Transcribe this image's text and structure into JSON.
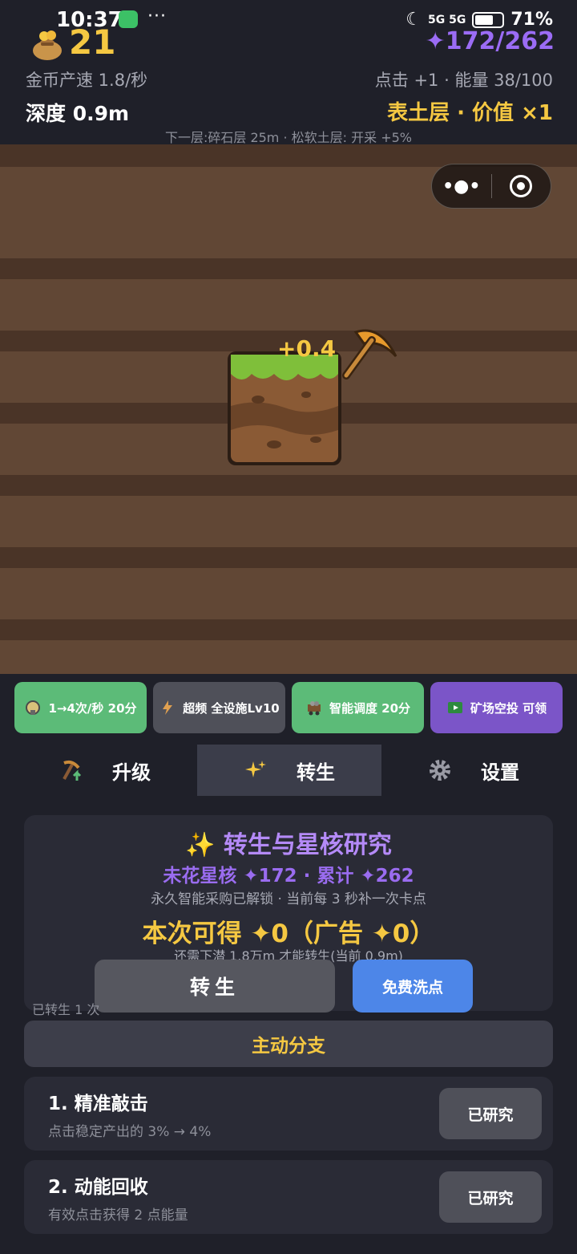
{
  "status_bar": {
    "time": "10:37",
    "dots": "···",
    "signal": "5G 5G",
    "battery": "71%"
  },
  "header": {
    "coins": "21",
    "stars": "✦172/262",
    "coin_rate": "金币产速 1.8/秒",
    "click_info": "点击 +1 · 能量 38/100",
    "depth": "深度 0.9m",
    "layer": "表土层 · 价值 ×1",
    "next_layer": "下一层:碎石层 25m · 松软土层: 开采 +5%"
  },
  "mine": {
    "float_gain": "+0.4"
  },
  "buffs": [
    {
      "label": "1→4次/秒 20分",
      "icon": "drill-icon",
      "color": "#5cbb78"
    },
    {
      "label": "超频 全设施Lv10",
      "icon": "lightning-icon",
      "color": "#4f5059"
    },
    {
      "label": "智能调度 20分",
      "icon": "minecart-icon",
      "color": "#5cbb78"
    },
    {
      "label": "矿场空投 可领",
      "icon": "video-icon",
      "color": "#7b55c8"
    }
  ],
  "tabs": [
    {
      "label": "升级",
      "icon": "pickaxe-up-icon"
    },
    {
      "label": "转生",
      "icon": "sparkles-icon",
      "active": true
    },
    {
      "label": "设置",
      "icon": "gear-icon"
    }
  ],
  "rebirth": {
    "title": "✨ 转生与星核研究",
    "core": "未花星核 ✦172 · 累计 ✦262",
    "auto": "永久智能采购已解锁 · 当前每 3 秒补一次卡点",
    "gain": "本次可得 ✦0（广告 ✦0）",
    "need": "还需下潜 1.8万m 才能转生(当前 0.9m)",
    "rebirth_button": "转生",
    "wash_button": "免费洗点",
    "count": "已转生 1 次"
  },
  "branch": {
    "label": "主动分支"
  },
  "research": [
    {
      "title": "1. 精准敲击",
      "desc": "点击稳定产出的 3% → 4%",
      "button": "已研究"
    },
    {
      "title": "2. 动能回收",
      "desc": "有效点击获得 2 点能量",
      "button": "已研究"
    }
  ],
  "colors": {
    "gold": "#f5c842",
    "purple": "#9b6cf5",
    "bg": "#1f2029",
    "dirt": "#614735"
  }
}
